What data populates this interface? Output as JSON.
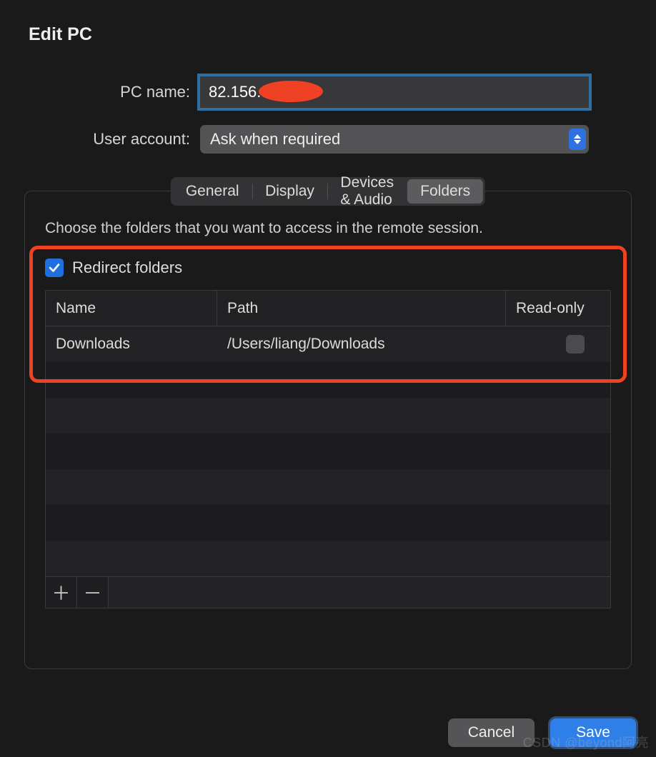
{
  "title": "Edit PC",
  "form": {
    "pc_name_label": "PC name:",
    "pc_name_value": "82.156.",
    "user_account_label": "User account:",
    "user_account_value": "Ask when required"
  },
  "tabs": [
    {
      "label": "General"
    },
    {
      "label": "Display"
    },
    {
      "label": "Devices & Audio"
    },
    {
      "label": "Folders",
      "active": true
    }
  ],
  "folders_panel": {
    "help_text": "Choose the folders that you want to access in the remote session.",
    "redirect_label": "Redirect folders",
    "redirect_checked": true,
    "table": {
      "headers": {
        "name": "Name",
        "path": "Path",
        "readonly": "Read-only"
      },
      "rows": [
        {
          "name": "Downloads",
          "path": "/Users/liang/Downloads",
          "readonly": false
        }
      ]
    }
  },
  "buttons": {
    "cancel": "Cancel",
    "save": "Save"
  },
  "watermark": "CSDN @beyond阿亮"
}
